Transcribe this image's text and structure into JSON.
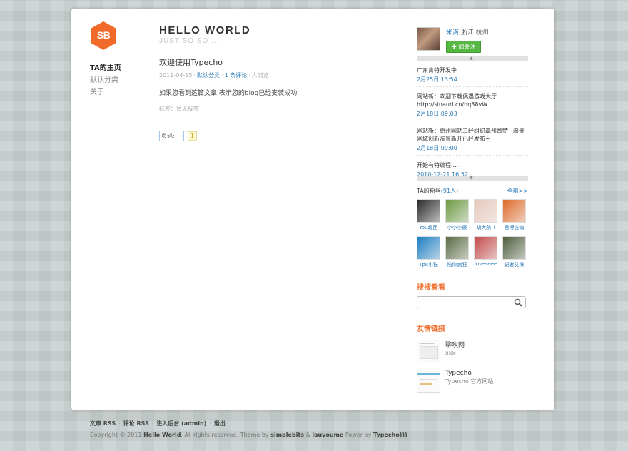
{
  "site": {
    "title": "HELLO WORLD",
    "subtitle": "JUST SO SO ...",
    "logo_text": "SB"
  },
  "nav": [
    {
      "label": "TA的主页",
      "active": true
    },
    {
      "label": "默认分类",
      "active": false
    },
    {
      "label": "关于",
      "active": false
    }
  ],
  "post": {
    "title": "欢迎使用Typecho",
    "date": "2011-04-15",
    "category": "默认分类",
    "comments": "1 条评论",
    "views": "人浏览",
    "body": "如果您看到这篇文章,表示您的blog已经安装成功.",
    "tags": "标签：暂无标签"
  },
  "pager": {
    "label": "页码:",
    "current": "1"
  },
  "profile": {
    "name": "米滴",
    "location": "浙江 杭州",
    "follow_label": "✚ 加关注"
  },
  "feed": [
    {
      "text": "广东肯特开发中",
      "time": "2月25日 13:54"
    },
    {
      "text": "网站新：欢迎下载偶遇游戏大厅 http://sinaurl.cn/hq38vW",
      "time": "2月18日 09:03"
    },
    {
      "text": "网站新：惠州网站三经组织嘉州肯特~淘景网城创新淘景新开已经发布~",
      "time": "2月18日 09:00"
    },
    {
      "text": "开始有特编程....",
      "time": "2010-12-21 16:52"
    }
  ],
  "fans": {
    "label": "TA的粉丝",
    "count": "(91人)",
    "all_label": "全部>>",
    "items": [
      {
        "name": "You趣团",
        "color": "#2b2b2b"
      },
      {
        "name": "小小小辰",
        "color": "#6d9a43"
      },
      {
        "name": "胡大院_i",
        "color": "#e9c7b9"
      },
      {
        "name": "思博咨询",
        "color": "#e06a28"
      },
      {
        "name": "Tpk小猫",
        "color": "#1e7fc4"
      },
      {
        "name": "陪你疯狂",
        "color": "#5a6a42"
      },
      {
        "name": "loveseee",
        "color": "#c54a4a"
      },
      {
        "name": "记者艾琳",
        "color": "#4e5d3a"
      }
    ]
  },
  "search": {
    "title": "搜搜看看",
    "placeholder": ""
  },
  "links": {
    "title": "友情链接",
    "items": [
      {
        "name": "聊吹网",
        "desc": "xxx"
      },
      {
        "name": "Typecho",
        "desc": "Typecho 官方网站"
      }
    ]
  },
  "footer": {
    "links": [
      "文章 RSS",
      "评论 RSS",
      "进入后台 (admin)",
      "退出"
    ],
    "copyright_pre": "Copyright © 2011 ",
    "copyright_site": "Hello World",
    "copyright_mid": ". All rights reserved. Theme by ",
    "theme_a": "simplebits",
    "amp": " & ",
    "theme_b": "lauyoume",
    "power_pre": " Power by ",
    "power": "Typecho)))"
  }
}
